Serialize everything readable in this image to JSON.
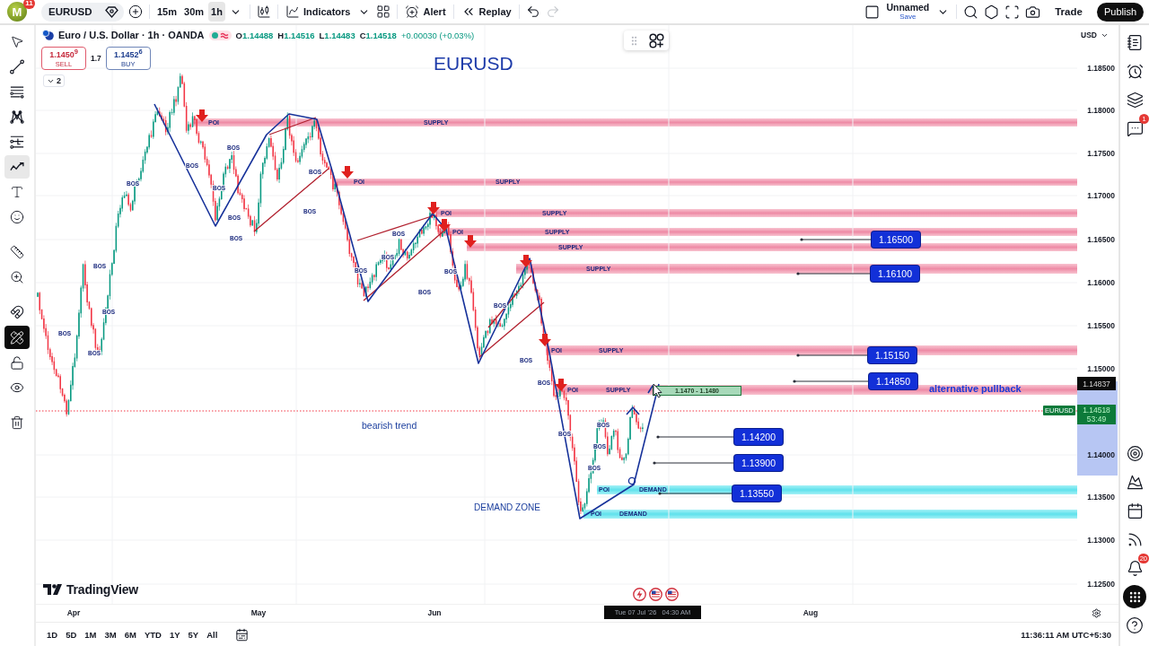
{
  "top_bar": {
    "avatar": "M",
    "avatar_badge": "11",
    "symbol": "EURUSD",
    "timeframes": [
      {
        "label": "15m",
        "selected": false
      },
      {
        "label": "30m",
        "selected": false
      },
      {
        "label": "1h",
        "selected": true
      }
    ],
    "indicators": "Indicators",
    "alert": "Alert",
    "replay": "Replay",
    "redo_disabled": true,
    "layout_name": "Unnamed",
    "layout_action": "Save",
    "trade": "Trade",
    "publish": "Publish"
  },
  "left_toolbar": {
    "tools": [
      {
        "selected": false,
        "pressed": false
      },
      {
        "selected": false,
        "pressed": false
      },
      {
        "selected": false,
        "pressed": false
      },
      {
        "selected": false,
        "pressed": false
      },
      {
        "selected": false,
        "pressed": false
      },
      {
        "selected": true,
        "pressed": false
      },
      {
        "selected": false,
        "pressed": false
      },
      {
        "selected": false,
        "pressed": false
      },
      {
        "selected": false,
        "pressed": false
      },
      {
        "selected": false,
        "pressed": false
      },
      {
        "selected": false,
        "pressed": false
      },
      {
        "selected": false,
        "pressed": true
      },
      {
        "selected": false,
        "pressed": false
      },
      {
        "selected": false,
        "pressed": false
      },
      {
        "selected": false,
        "pressed": false
      }
    ]
  },
  "legend": {
    "title": "Euro / U.S. Dollar · 1h · OANDA",
    "ohlc": [
      {
        "key": "O",
        "value": "1.14488"
      },
      {
        "key": "H",
        "value": "1.14516"
      },
      {
        "key": "L",
        "value": "1.14483"
      },
      {
        "key": "C",
        "value": "1.14518"
      }
    ],
    "change": "+0.00030 (+0.03%)",
    "sell": {
      "price": "1.1450$^{9}$",
      "label": "SELL"
    },
    "spread": "1.7",
    "buy": {
      "price": "1.1452$^{6}$",
      "label": "BUY"
    },
    "indicator_count": "2"
  },
  "chart": {
    "title": "EURUSD",
    "zones": [
      {
        "kind": "supply",
        "label": "SUPPLY",
        "poi": "POI"
      },
      {
        "kind": "supply",
        "label": "SUPPLY",
        "poi": "POI"
      },
      {
        "kind": "supply",
        "label": "SUPPLY",
        "poi": "POI"
      },
      {
        "kind": "supply",
        "label": "SUPPLY",
        "poi": "POI"
      },
      {
        "kind": "supply",
        "label": "SUPPLY"
      },
      {
        "kind": "supply",
        "label": "SUPPLY"
      },
      {
        "kind": "supply",
        "label": "SUPPLY",
        "poi": "POI"
      },
      {
        "kind": "supply",
        "label": "SUPPLY",
        "poi": "POI"
      },
      {
        "kind": "demand",
        "label": "DEMAND",
        "poi": "POI"
      },
      {
        "kind": "demand",
        "label": "DEMAND",
        "poi": "POI"
      }
    ],
    "bos_labels": [
      "BOS",
      "BOS",
      "BOS",
      "BOS",
      "BOS",
      "BOS",
      "BOS",
      "BOS",
      "BOS",
      "BOS",
      "BOS",
      "BOS",
      "BOS",
      "BOS",
      "BOS",
      "BOS",
      "BOS",
      "BOS",
      "BOS",
      "BOS",
      "BOS",
      "BOS",
      "BOS",
      "BOS"
    ],
    "targets": [
      "1.16500",
      "1.16100",
      "1.15150",
      "1.14850",
      "1.14200",
      "1.13900",
      "1.13550"
    ],
    "range_box": "1.1470 - 1.1480",
    "trend_note": "bearish trend",
    "zone_note": "DEMAND ZONE",
    "pullback_note": "alternative pullback",
    "branding": "TradingView"
  },
  "price_axis": {
    "currency": "USD",
    "ticks": [
      "1.18500",
      "1.18000",
      "1.17500",
      "1.17000",
      "1.16500",
      "1.16000",
      "1.15500",
      "1.15000",
      "1.14000",
      "1.13500",
      "1.13000",
      "1.12500"
    ],
    "crosshair_price": "1.14837",
    "symbol_tag": "EURUSD",
    "last_price": "1.14518",
    "countdown": "53:49"
  },
  "time_axis": {
    "labels": [
      "Apr",
      "May",
      "Jun",
      "Aug"
    ],
    "cursor_time": "Tue 07 Jul '26   04:30 AM"
  },
  "bottom_bar": {
    "ranges": [
      "1D",
      "5D",
      "1M",
      "3M",
      "6M",
      "YTD",
      "1Y",
      "5Y",
      "All"
    ],
    "clock": "11:36:11 AM UTC+5:30"
  },
  "right_sidebar": {
    "chat_badge": "1",
    "alerts_badge": "20"
  }
}
